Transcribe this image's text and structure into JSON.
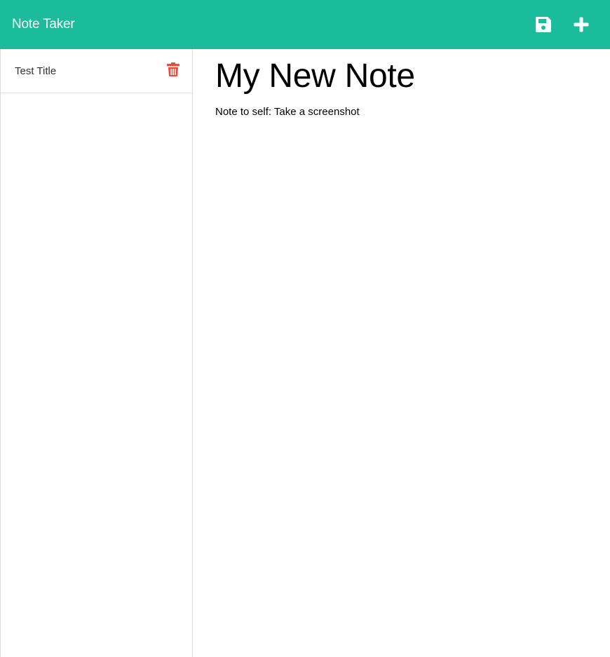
{
  "navbar": {
    "brand": "Note Taker",
    "icons": {
      "save": "save-icon",
      "add": "plus-icon"
    },
    "color": "#1abc9c"
  },
  "sidebar": {
    "items": [
      {
        "title": "Test Title",
        "icon": "trash-icon",
        "icon_color": "#e74c3c"
      }
    ]
  },
  "note": {
    "title": "My New Note",
    "text": "Note to self: Take a screenshot"
  }
}
